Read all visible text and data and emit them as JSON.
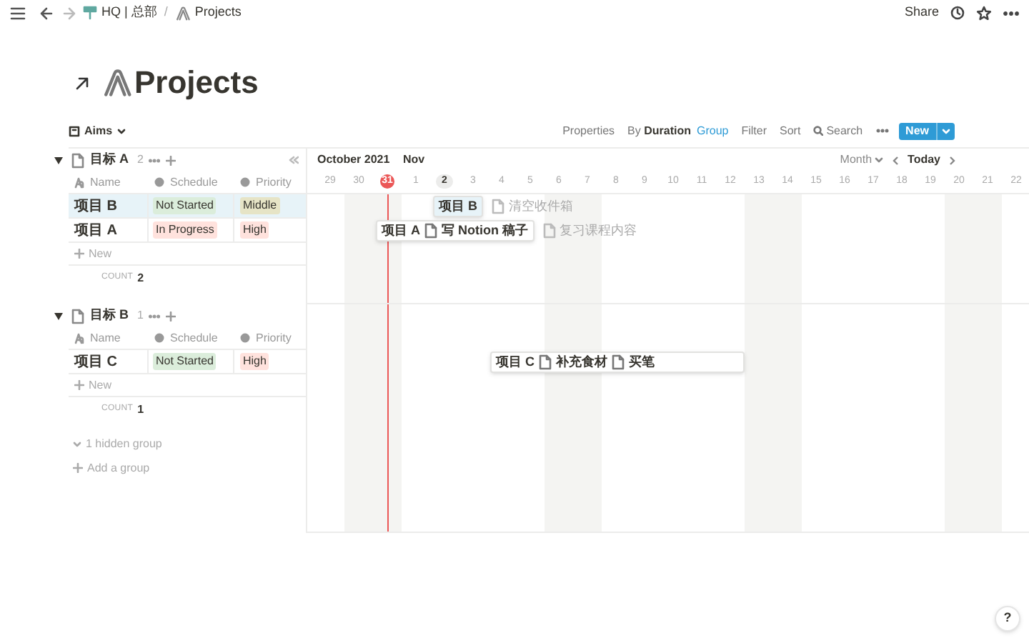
{
  "breadcrumb": [
    {
      "label": "HQ | 总部"
    },
    {
      "label": "Projects"
    }
  ],
  "separator": "/",
  "share": "Share",
  "title": "Projects",
  "view": {
    "name": "Aims"
  },
  "toolbar": {
    "properties": "Properties",
    "by": "By",
    "by_value": "Duration",
    "group": "Group",
    "filter": "Filter",
    "sort": "Sort",
    "search": "Search",
    "new": "New"
  },
  "timeline": {
    "months": [
      "October 2021",
      "Nov"
    ],
    "scale": "Month",
    "today": "Today",
    "days": [
      {
        "label": "29",
        "weekend": false,
        "today": false,
        "highlighted": false
      },
      {
        "label": "30",
        "weekend": true,
        "today": false,
        "highlighted": false
      },
      {
        "label": "31",
        "weekend": true,
        "today": true,
        "highlighted": false
      },
      {
        "label": "1",
        "weekend": false,
        "today": false,
        "highlighted": false
      },
      {
        "label": "2",
        "weekend": false,
        "today": false,
        "highlighted": true
      },
      {
        "label": "3",
        "weekend": false,
        "today": false,
        "highlighted": false
      },
      {
        "label": "4",
        "weekend": false,
        "today": false,
        "highlighted": false
      },
      {
        "label": "5",
        "weekend": false,
        "today": false,
        "highlighted": false
      },
      {
        "label": "6",
        "weekend": true,
        "today": false,
        "highlighted": false
      },
      {
        "label": "7",
        "weekend": true,
        "today": false,
        "highlighted": false
      },
      {
        "label": "8",
        "weekend": false,
        "today": false,
        "highlighted": false
      },
      {
        "label": "9",
        "weekend": false,
        "today": false,
        "highlighted": false
      },
      {
        "label": "10",
        "weekend": false,
        "today": false,
        "highlighted": false
      },
      {
        "label": "11",
        "weekend": false,
        "today": false,
        "highlighted": false
      },
      {
        "label": "12",
        "weekend": false,
        "today": false,
        "highlighted": false
      },
      {
        "label": "13",
        "weekend": true,
        "today": false,
        "highlighted": false
      },
      {
        "label": "14",
        "weekend": true,
        "today": false,
        "highlighted": false
      },
      {
        "label": "15",
        "weekend": false,
        "today": false,
        "highlighted": false
      },
      {
        "label": "16",
        "weekend": false,
        "today": false,
        "highlighted": false
      },
      {
        "label": "17",
        "weekend": false,
        "today": false,
        "highlighted": false
      },
      {
        "label": "18",
        "weekend": false,
        "today": false,
        "highlighted": false
      },
      {
        "label": "19",
        "weekend": false,
        "today": false,
        "highlighted": false
      },
      {
        "label": "20",
        "weekend": true,
        "today": false,
        "highlighted": false
      },
      {
        "label": "21",
        "weekend": true,
        "today": false,
        "highlighted": false
      },
      {
        "label": "22",
        "weekend": false,
        "today": false,
        "highlighted": false
      }
    ]
  },
  "groups": [
    {
      "name": "目标 A",
      "count": "2",
      "expanded": true,
      "columns": [
        "Name",
        "Schedule",
        "Priority"
      ],
      "new_label": "New",
      "count_label": "COUNT",
      "count_value": "2",
      "rows": [
        {
          "name": "项目 B",
          "selected": true,
          "schedule": {
            "label": "Not Started",
            "color": "#dbeddb"
          },
          "priority": {
            "label": "Middle",
            "color": "#e6e4c6"
          },
          "bar": {
            "name": "项目 B",
            "outside": [
              "清空收件箱"
            ]
          }
        },
        {
          "name": "项目 A",
          "selected": false,
          "schedule": {
            "label": "In Progress",
            "color": "#ffe2dd"
          },
          "priority": {
            "label": "High",
            "color": "#ffe2dd"
          },
          "bar": {
            "name": "项目 A",
            "inside": [
              "写 Notion 稿子"
            ],
            "outside": [
              "复习课程内容"
            ]
          }
        }
      ]
    },
    {
      "name": "目标 B",
      "count": "1",
      "expanded": true,
      "columns": [
        "Name",
        "Schedule",
        "Priority"
      ],
      "new_label": "New",
      "count_label": "COUNT",
      "count_value": "1",
      "rows": [
        {
          "name": "项目 C",
          "selected": false,
          "schedule": {
            "label": "Not Started",
            "color": "#dbeddb"
          },
          "priority": {
            "label": "High",
            "color": "#ffe2dd"
          },
          "bar": {
            "name": "项目 C",
            "inside": [
              "补充食材",
              "买笔"
            ]
          }
        }
      ]
    }
  ],
  "hidden_groups": "1 hidden group",
  "add_group": "Add a group",
  "help": "?"
}
